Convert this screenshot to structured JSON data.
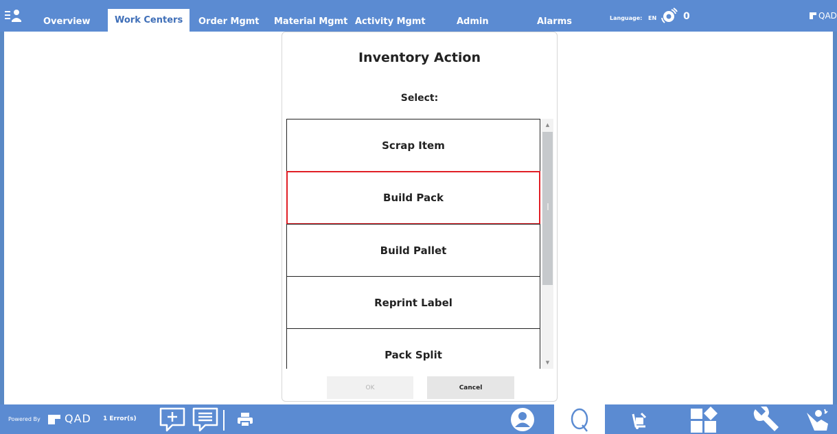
{
  "nav": {
    "tabs": [
      {
        "label": "Overview"
      },
      {
        "label": "Work Centers"
      },
      {
        "label": "Order Mgmt"
      },
      {
        "label": "Material Mgmt"
      },
      {
        "label": "Activity Mgmt"
      },
      {
        "label": "Admin"
      },
      {
        "label": "Alarms"
      }
    ],
    "active_tab": "Work Centers",
    "language_label": "Language:",
    "language_value": "EN",
    "alarm_count": "0",
    "brand": "QAD"
  },
  "dialog": {
    "title": "Inventory Action",
    "subtitle": "Select:",
    "items": [
      {
        "label": "Scrap Item"
      },
      {
        "label": "Build Pack"
      },
      {
        "label": "Build Pallet"
      },
      {
        "label": "Reprint Label"
      },
      {
        "label": "Pack Split"
      }
    ],
    "selected_item": "Build Pack",
    "ok_label": "OK",
    "cancel_label": "Cancel"
  },
  "footer": {
    "powered_by": "Powered By",
    "brand": "QAD",
    "errors": "1 Error(s)",
    "icons": [
      "add-comment-icon",
      "message-icon",
      "print-icon",
      "user-icon",
      "search-q-icon",
      "cart-icon",
      "layout-icon",
      "wrench-icon",
      "operator-icon"
    ]
  },
  "colors": {
    "bar": "#5b8bd2",
    "active_tab_text": "#3f6fb8",
    "selected_border": "#e01e25"
  }
}
